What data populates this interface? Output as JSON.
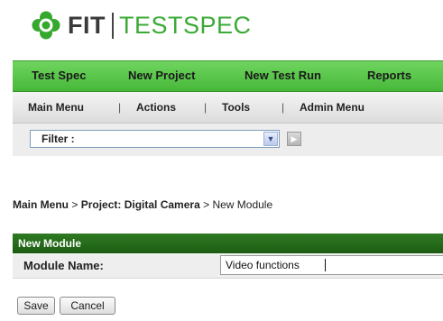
{
  "brand": {
    "name_left": "FIT",
    "name_right": "TESTSPEC"
  },
  "top_nav": {
    "items": [
      "Test Spec",
      "New Project",
      "New Test Run",
      "Reports"
    ]
  },
  "menu_bar": {
    "items": [
      "Main Menu",
      "Actions",
      "Tools",
      "Admin Menu"
    ],
    "separator": "|"
  },
  "filter": {
    "label": "Filter :"
  },
  "breadcrumb": {
    "part1": "Main Menu",
    "sep": ">",
    "part2": "Project: Digital Camera",
    "part3": "New Module"
  },
  "form": {
    "title": "New Module",
    "field_label": "Module Name:",
    "field_value": "Video functions",
    "save_label": "Save",
    "cancel_label": "Cancel"
  },
  "colors": {
    "brand_green": "#3aaa35",
    "nav_green": "#56c447",
    "panel_header_green": "#236b18"
  }
}
